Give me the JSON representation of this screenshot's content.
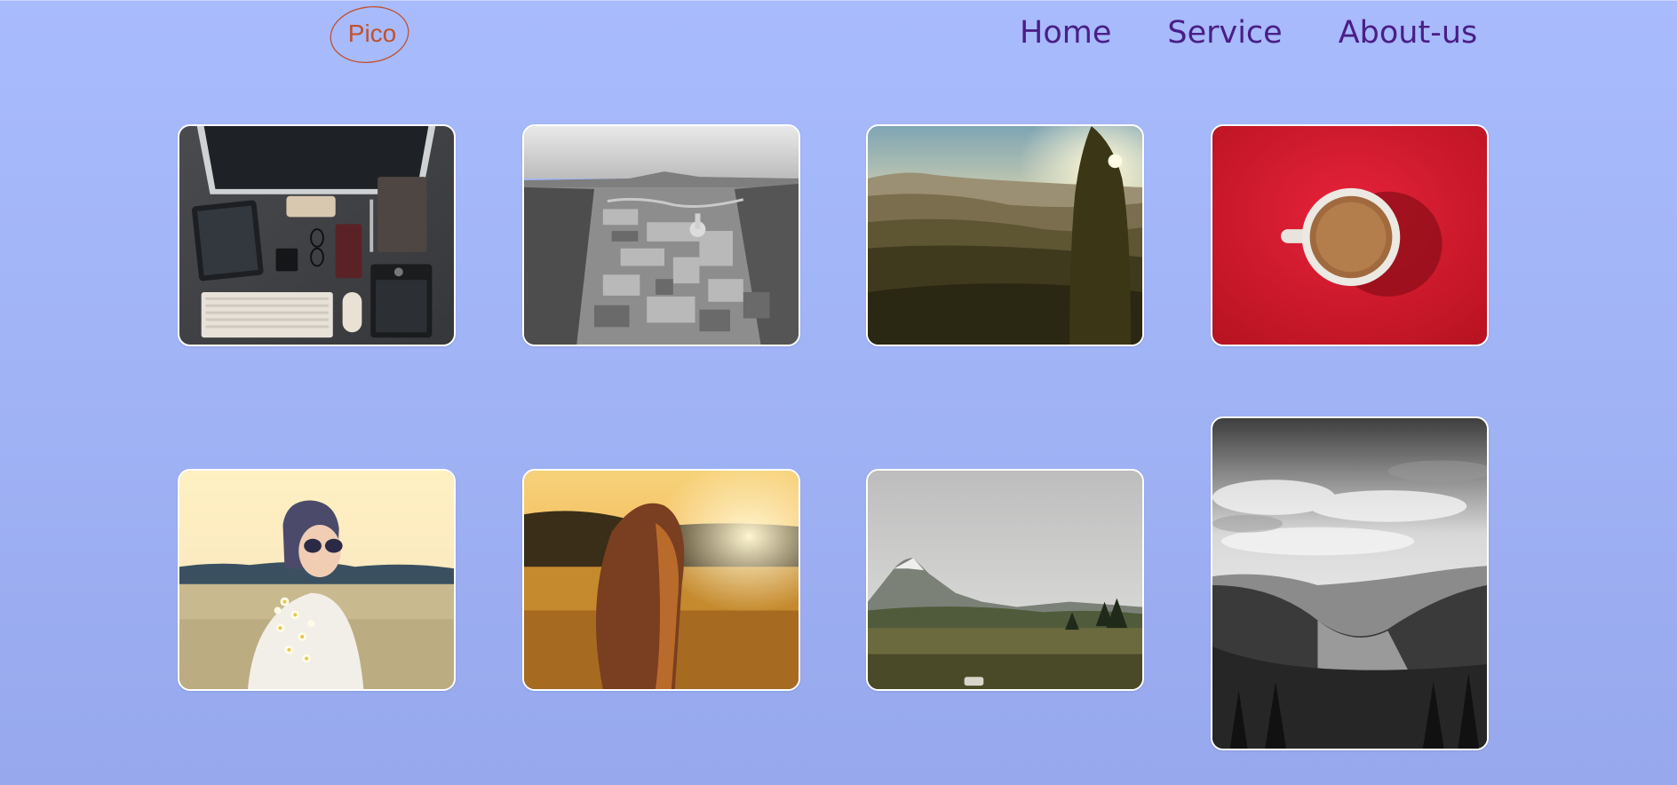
{
  "header": {
    "logo_text": "Pico",
    "logo_color": "#c0512e",
    "nav_color": "#4a1e86",
    "nav": [
      {
        "label": "Home"
      },
      {
        "label": "Service"
      },
      {
        "label": "About-us"
      }
    ]
  },
  "gallery": {
    "photos": [
      {
        "subject": "desk-workspace-flatlay"
      },
      {
        "subject": "black-white-city-aerial"
      },
      {
        "subject": "sunset-hills-tree"
      },
      {
        "subject": "coffee-cup-red-background"
      },
      {
        "subject": "woman-sunglasses-field"
      },
      {
        "subject": "girl-golden-field-sunset"
      },
      {
        "subject": "mountain-valley-meadow"
      },
      {
        "subject": "black-white-forest-valley"
      }
    ]
  },
  "colors": {
    "background_top": "#a8bbfd",
    "background_bottom": "#97a8ec",
    "photo_border": "#ffffff"
  }
}
